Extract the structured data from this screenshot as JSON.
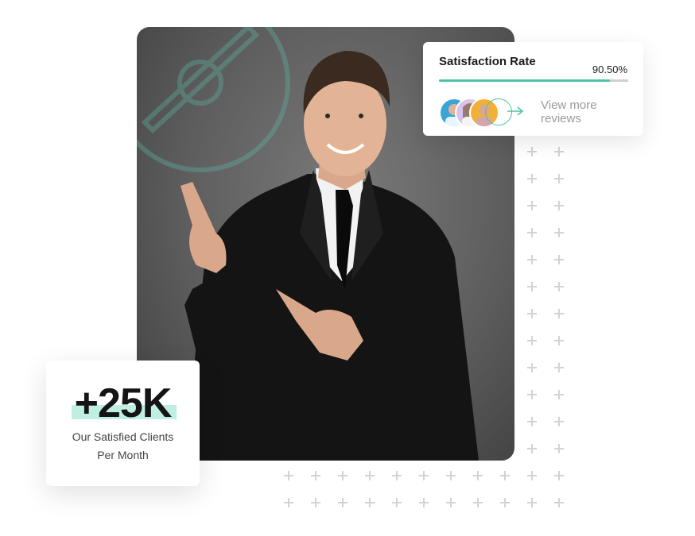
{
  "satisfaction": {
    "title": "Satisfaction Rate",
    "value_text": "90.50%",
    "value_fraction": 0.905,
    "reviews_link": "View more reviews",
    "accent_color": "#4cc3a6"
  },
  "clients": {
    "count": "+25K",
    "label_line1": "Our Satisfied Clients",
    "label_line2": "Per Month",
    "highlight_color": "#bfeee2"
  },
  "icons": [
    "plus-decoration",
    "arrow-right-icon",
    "compass-watermark"
  ]
}
